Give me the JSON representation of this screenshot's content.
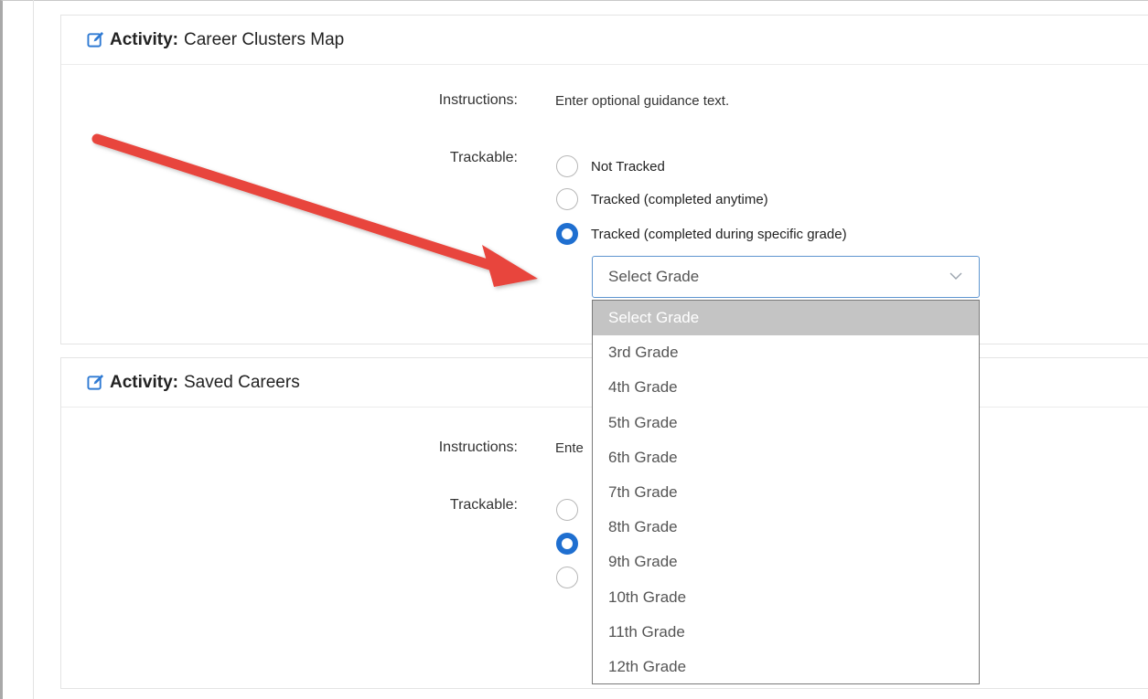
{
  "activities": [
    {
      "header_prefix": "Activity:",
      "header_title": "Career Clusters Map",
      "instructions_label": "Instructions:",
      "instructions_value": "Enter optional guidance text.",
      "trackable_label": "Trackable:",
      "options": [
        "Not Tracked",
        "Tracked (completed anytime)",
        "Tracked (completed during specific grade)"
      ],
      "selected_option": 2
    },
    {
      "header_prefix": "Activity:",
      "header_title": "Saved Careers",
      "instructions_label": "Instructions:",
      "instructions_value_visible": "Ente",
      "trackable_label": "Trackable:",
      "selected_option": 1
    }
  ],
  "grade_select": {
    "current_value": "Select Grade",
    "options": [
      "Select Grade",
      "3rd Grade",
      "4th Grade",
      "5th Grade",
      "6th Grade",
      "7th Grade",
      "8th Grade",
      "9th Grade",
      "10th Grade",
      "11th Grade",
      "12th Grade"
    ],
    "highlighted_option": 0
  },
  "colors": {
    "radio_checked": "#1f6fd0",
    "annotation_arrow": "#e8453c",
    "select_border": "#5f95cf",
    "highlight_bg": "#c4c4c4"
  },
  "icons": {
    "header_icon": "edit-icon",
    "select_icon": "chevron-down-icon",
    "annotation": "red-arrow-annotation"
  }
}
